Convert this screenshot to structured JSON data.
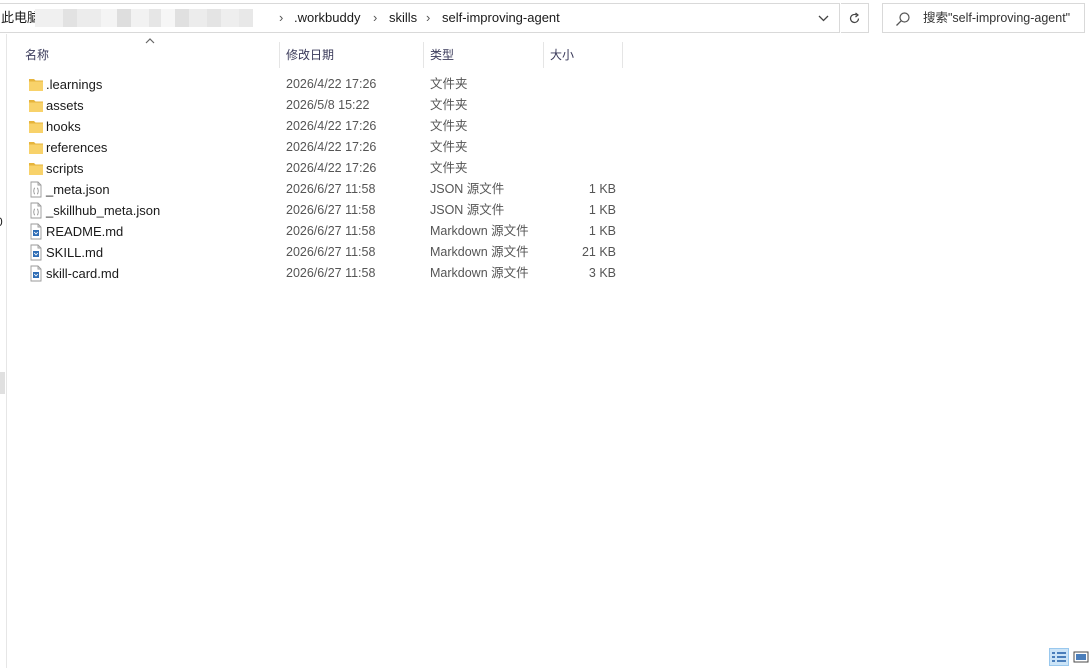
{
  "address": {
    "root_label": "此电脑",
    "crumbs": [
      ".workbuddy",
      "skills",
      "self-improving-agent"
    ],
    "separator": "›"
  },
  "search": {
    "placeholder": "搜索\"self-improving-agent\""
  },
  "left_strip": {
    "digit": "0"
  },
  "columns": {
    "name": "名称",
    "date": "修改日期",
    "type": "类型",
    "size": "大小"
  },
  "files": [
    {
      "name": ".learnings",
      "date": "2026/4/22 17:26",
      "type": "文件夹",
      "size": "",
      "icon": "folder-icon"
    },
    {
      "name": "assets",
      "date": "2026/5/8 15:22",
      "type": "文件夹",
      "size": "",
      "icon": "folder-icon"
    },
    {
      "name": "hooks",
      "date": "2026/4/22 17:26",
      "type": "文件夹",
      "size": "",
      "icon": "folder-icon"
    },
    {
      "name": "references",
      "date": "2026/4/22 17:26",
      "type": "文件夹",
      "size": "",
      "icon": "folder-icon"
    },
    {
      "name": "scripts",
      "date": "2026/4/22 17:26",
      "type": "文件夹",
      "size": "",
      "icon": "folder-icon"
    },
    {
      "name": "_meta.json",
      "date": "2026/6/27 11:58",
      "type": "JSON 源文件",
      "size": "1 KB",
      "icon": "json-file-icon"
    },
    {
      "name": "_skillhub_meta.json",
      "date": "2026/6/27 11:58",
      "type": "JSON 源文件",
      "size": "1 KB",
      "icon": "json-file-icon"
    },
    {
      "name": "README.md",
      "date": "2026/6/27 11:58",
      "type": "Markdown 源文件",
      "size": "1 KB",
      "icon": "markdown-file-icon"
    },
    {
      "name": "SKILL.md",
      "date": "2026/6/27 11:58",
      "type": "Markdown 源文件",
      "size": "21 KB",
      "icon": "markdown-file-icon"
    },
    {
      "name": "skill-card.md",
      "date": "2026/6/27 11:58",
      "type": "Markdown 源文件",
      "size": "3 KB",
      "icon": "markdown-file-icon"
    }
  ],
  "colors": {
    "folder": "#f8d26a",
    "folder_dark": "#e6b43c",
    "accent": "#0078d7",
    "header_text": "#3a3a5a"
  }
}
